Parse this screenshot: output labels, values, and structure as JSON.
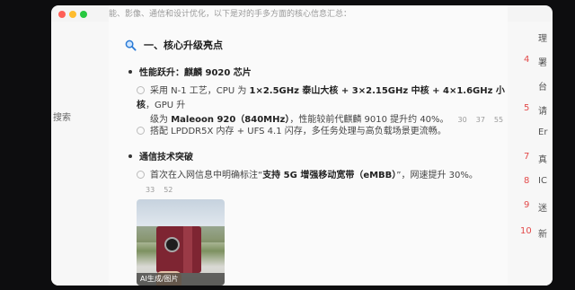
{
  "window": {
    "controls": [
      "close",
      "minimize",
      "maximize"
    ]
  },
  "left_panel": {
    "text": "搜索"
  },
  "main": {
    "top_line": "能、影像、通信和设计优化，以下是对的手多方面的核心信息汇总：",
    "section_title": "一、核心升级亮点",
    "sections": [
      {
        "title": "性能跃升：麒麟 9020 芯片",
        "items": [
          {
            "line1_pre": "采用 N-1 工艺，CPU 为 ",
            "line1_bold": "1×2.5GHz 泰山大核 + 3×2.15GHz 中核 + 4×1.6GHz 小核",
            "line1_post": "，GPU 升",
            "line2_pre": "级为 ",
            "line2_bold": "Maleoon 920（840MHz）",
            "line2_post": "，性能较前代麒麟 9010 提升约 40%。",
            "cites": [
              "30",
              "37",
              "55"
            ]
          },
          {
            "text": "搭配 LPDDR5X 内存 + UFS 4.1 闪存，多任务处理与高负载场景更流畅。"
          }
        ]
      },
      {
        "title": "通信技术突破",
        "items": [
          {
            "pre": "首次在入网信息中明确标注“",
            "bold": "支持 5G 增强移动宽带（eMBB）",
            "post": "”，网速提升 30%。",
            "cites": [
              "33",
              "52"
            ],
            "cite_wrap": "55"
          }
        ]
      }
    ],
    "image_caption": "AI生成/图片"
  },
  "references": [
    {
      "num": "",
      "ch": "理"
    },
    {
      "num": "4",
      "ch": "署"
    },
    {
      "num": "",
      "ch": "台"
    },
    {
      "num": "5",
      "ch": "请"
    },
    {
      "num": "",
      "ch": "Er"
    },
    {
      "num": "7",
      "ch": "真"
    },
    {
      "num": "8",
      "ch": "IC"
    },
    {
      "num": "9",
      "ch": "迷"
    },
    {
      "num": "10",
      "ch": "新"
    }
  ]
}
